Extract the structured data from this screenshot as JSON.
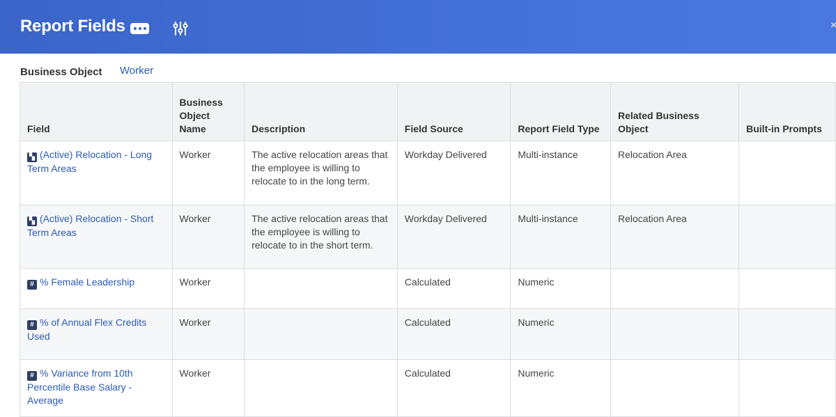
{
  "header": {
    "title": "Report Fields"
  },
  "business_object": {
    "label": "Business Object",
    "value": "Worker"
  },
  "table": {
    "columns": [
      "Field",
      "Business Object Name",
      "Description",
      "Field Source",
      "Report Field Type",
      "Related Business Object",
      "Built-in Prompts"
    ],
    "rows": [
      {
        "field": "(Active) Relocation - Long Term Areas",
        "field_icon": "multi-instance-icon",
        "bo_name": "Worker",
        "description": "The active relocation areas that the employee is willing to relocate to in the long term.",
        "source": "Workday Delivered",
        "type": "Multi-instance",
        "related": "Relocation Area",
        "prompts": ""
      },
      {
        "field": "(Active) Relocation - Short Term Areas",
        "field_icon": "multi-instance-icon",
        "bo_name": "Worker",
        "description": "The active relocation areas that the employee is willing to relocate to in the short term.",
        "source": "Workday Delivered",
        "type": "Multi-instance",
        "related": "Relocation Area",
        "prompts": ""
      },
      {
        "field": "% Female Leadership",
        "field_icon": "numeric-icon",
        "bo_name": "Worker",
        "description": "",
        "source": "Calculated",
        "type": "Numeric",
        "related": "",
        "prompts": ""
      },
      {
        "field": "% of Annual Flex Credits Used",
        "field_icon": "numeric-icon",
        "bo_name": "Worker",
        "description": "",
        "source": "Calculated",
        "type": "Numeric",
        "related": "",
        "prompts": ""
      },
      {
        "field": "% Variance from 10th Percentile Base Salary - Average",
        "field_icon": "numeric-icon",
        "bo_name": "Worker",
        "description": "",
        "source": "Calculated",
        "type": "Numeric",
        "related": "",
        "prompts": ""
      }
    ]
  }
}
